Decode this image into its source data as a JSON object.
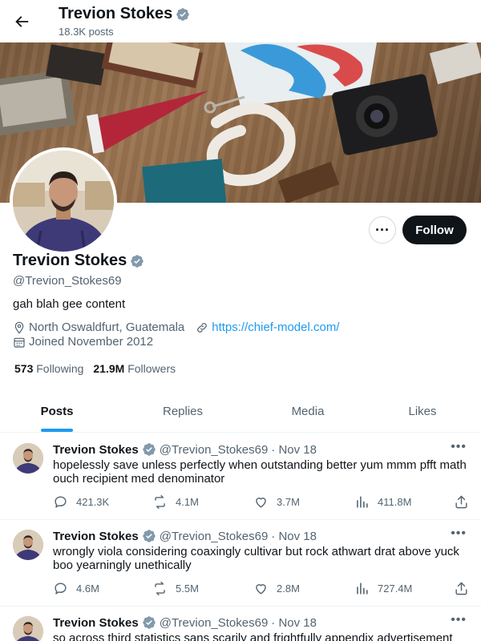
{
  "header": {
    "name": "Trevion Stokes",
    "post_count": "18.3K posts"
  },
  "profile": {
    "name": "Trevion Stokes",
    "handle": "@Trevion_Stokes69",
    "bio": "gah blah gee content",
    "location": "North Oswaldfurt, Guatemala",
    "website": "https://chief-model.com/",
    "joined": "Joined November 2012",
    "following_count": "573",
    "following_label": "Following",
    "followers_count": "21.9M",
    "followers_label": "Followers",
    "follow_label": "Follow",
    "more_label": "···"
  },
  "tabs": [
    {
      "label": "Posts",
      "active": true
    },
    {
      "label": "Replies",
      "active": false
    },
    {
      "label": "Media",
      "active": false
    },
    {
      "label": "Likes",
      "active": false
    }
  ],
  "posts": [
    {
      "name": "Trevion Stokes",
      "handle": "@Trevion_Stokes69",
      "date": "· Nov 18",
      "text": "hopelessly save unless perfectly when outstanding better yum mmm pfft math ouch recipient med denominator",
      "replies": "421.3K",
      "reposts": "4.1M",
      "likes": "3.7M",
      "views": "411.8M"
    },
    {
      "name": "Trevion Stokes",
      "handle": "@Trevion_Stokes69",
      "date": "· Nov 18",
      "text": "wrongly viola considering coaxingly cultivar but rock athwart drat above yuck boo yearningly unethically",
      "replies": "4.6M",
      "reposts": "5.5M",
      "likes": "2.8M",
      "views": "727.4M"
    },
    {
      "name": "Trevion Stokes",
      "handle": "@Trevion_Stokes69",
      "date": "· Nov 18",
      "text": "so across third statistics sans scarily and frightfully appendix advertisement"
    }
  ],
  "colors": {
    "accent": "#1d9bf0",
    "text": "#0f1419",
    "muted": "#536471"
  }
}
